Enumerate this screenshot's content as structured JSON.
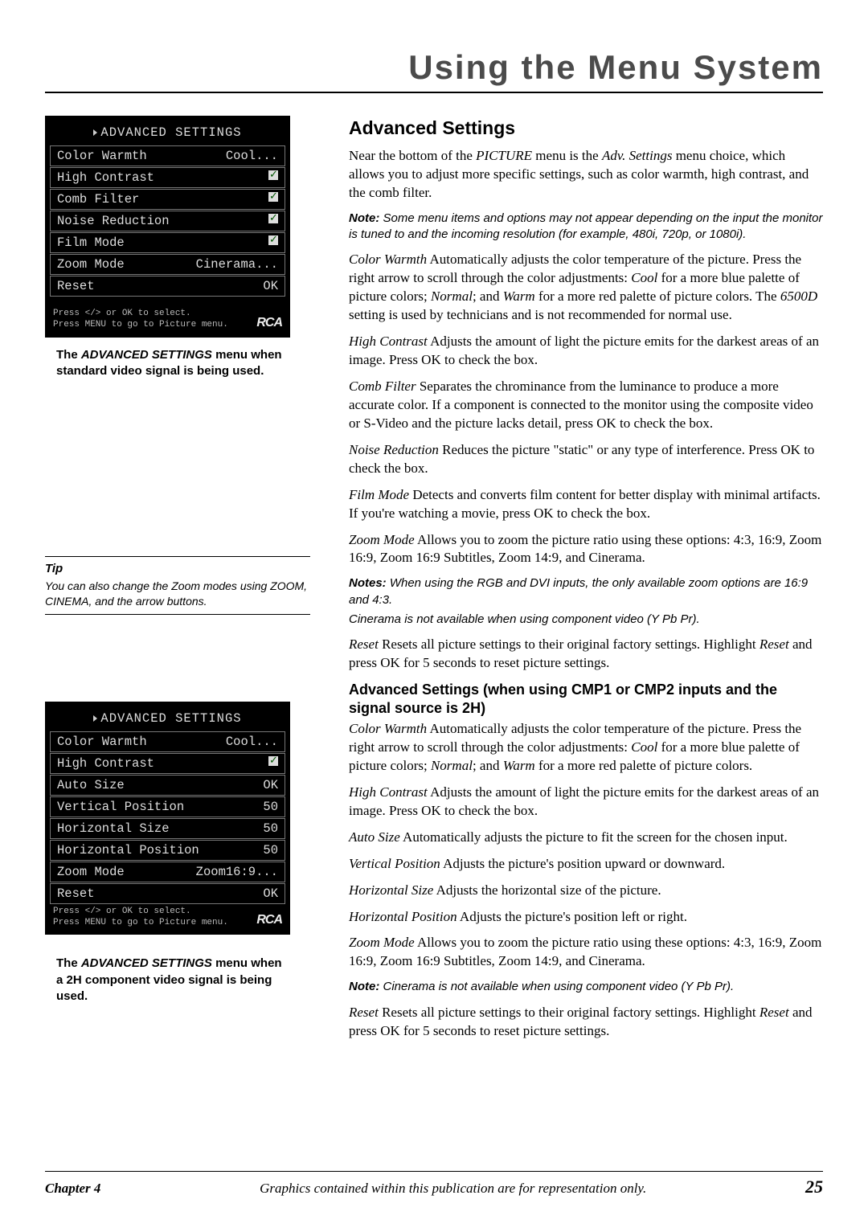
{
  "header": {
    "title": "Using the Menu System"
  },
  "osd1": {
    "title": "ADVANCED SETTINGS",
    "rows": [
      {
        "label": "Color Warmth",
        "value": "Cool...",
        "check": false
      },
      {
        "label": "High Contrast",
        "value": "",
        "check": true
      },
      {
        "label": "Comb Filter",
        "value": "",
        "check": true
      },
      {
        "label": "Noise Reduction",
        "value": "",
        "check": true
      },
      {
        "label": "Film Mode",
        "value": "",
        "check": true
      },
      {
        "label": "Zoom Mode",
        "value": "Cinerama...",
        "check": false
      },
      {
        "label": "Reset",
        "value": "OK",
        "check": false
      }
    ],
    "foot1": "Press </> or OK to select.",
    "foot2": "Press MENU to go to Picture menu.",
    "brand": "RCA"
  },
  "caption1_a": "The ",
  "caption1_b": "ADVANCED SETTINGS",
  "caption1_c": " menu when standard video signal is being used.",
  "tip": {
    "title": "Tip",
    "body": "You can also change the Zoom modes using ZOOM, CINEMA, and the arrow buttons."
  },
  "osd2": {
    "title": "ADVANCED SETTINGS",
    "rows": [
      {
        "label": "Color Warmth",
        "value": "Cool...",
        "check": false
      },
      {
        "label": "High Contrast",
        "value": "",
        "check": true
      },
      {
        "label": "Auto Size",
        "value": "OK",
        "check": false
      },
      {
        "label": "Vertical Position",
        "value": "50",
        "check": false
      },
      {
        "label": "Horizontal Size",
        "value": "50",
        "check": false
      },
      {
        "label": "Horizontal Position",
        "value": "50",
        "check": false
      },
      {
        "label": "Zoom Mode",
        "value": "Zoom16:9...",
        "check": false
      },
      {
        "label": "Reset",
        "value": "OK",
        "check": false
      }
    ],
    "foot1": "Press </> or OK to select.",
    "foot2": "Press MENU to go to Picture menu.",
    "brand": "RCA"
  },
  "caption2_a": "The ",
  "caption2_b": "ADVANCED SETTINGS",
  "caption2_c": " menu when a 2H component video signal is being used.",
  "right": {
    "h2": "Advanced Settings",
    "intro1": "Near the bottom of the ",
    "intro2": "PICTURE",
    "intro3": " menu is the ",
    "intro4": "Adv. Settings",
    "intro5": " menu choice, which allows you to adjust more specific settings, such as color warmth, high contrast, and the comb filter.",
    "note1_label": "Note:",
    "note1_body": " Some menu items and options may not appear depending on the input the monitor is tuned to and the incoming resolution (for example, 480i, 720p, or 1080i).",
    "cw_t": "Color Warmth",
    "cw_b1": "   Automatically adjusts the color temperature of the picture. Press the right arrow to scroll through the color adjustments: ",
    "cw_cool": "Cool",
    "cw_b2": " for a more blue palette of picture colors; ",
    "cw_normal": "Normal",
    "cw_b3": "; and ",
    "cw_warm": "Warm",
    "cw_b4": " for a more red palette of picture colors. The ",
    "cw_6500": "6500D",
    "cw_b5": " setting is used by technicians and is not recommended for normal use.",
    "hc_t": "High Contrast",
    "hc_b": "   Adjusts the amount of light the picture emits for the darkest areas of an image. Press OK to check the box.",
    "cf_t": "Comb Filter",
    "cf_b": "   Separates the chrominance from the luminance to produce a more accurate color. If a component is connected to the monitor using the composite video or S-Video and the picture lacks detail, press OK to check the box.",
    "nr_t": "Noise Reduction",
    "nr_b": "    Reduces the picture \"static\" or any type of interference. Press OK to check the box.",
    "fm_t": "Film Mode",
    "fm_b": "   Detects and converts film content for better display with minimal artifacts. If you're watching a movie, press OK to check the box.",
    "zm_t": "Zoom Mode",
    "zm_b": "   Allows you to zoom the picture ratio using these options: 4:3, 16:9, Zoom 16:9, Zoom 16:9 Subtitles, Zoom 14:9, and Cinerama.",
    "notes2_label": "Notes:",
    "notes2_a": " When using the RGB and DVI inputs, the only available zoom options are 16:9 and 4:3.",
    "notes2_b": "Cinerama is not available when using component video (Y Pb Pr).",
    "rs_t": "Reset",
    "rs_b1": "   Resets all picture settings to their original factory settings. Highlight ",
    "rs_reset": "Reset",
    "rs_b2": " and press OK for 5 seconds to reset picture settings.",
    "h3": "Advanced Settings (when using CMP1 or CMP2 inputs and the signal source is 2H)",
    "cw2_t": "Color Warmth",
    "cw2_b1": "   Automatically adjusts the color temperature of the picture. Press the right arrow to scroll through the color adjustments: ",
    "cw2_cool": "Cool",
    "cw2_b2": " for a more blue palette of picture colors; ",
    "cw2_normal": "Normal",
    "cw2_b3": "; and ",
    "cw2_warm": "Warm",
    "cw2_b4": " for a more red palette of picture colors.",
    "hc2_t": "High Contrast",
    "hc2_b": "   Adjusts the amount of light the picture emits for the darkest areas of an image. Press OK to check the box.",
    "as_t": "Auto Size",
    "as_b": "   Automatically adjusts the picture to fit the screen for the chosen input.",
    "vp_t": "Vertical Position",
    "vp_b": "   Adjusts the picture's position upward or downward.",
    "hs_t": "Horizontal Size",
    "hs_b": "   Adjusts the horizontal size of the picture.",
    "hp_t": "Horizontal Position",
    "hp_b": "   Adjusts the picture's position left or right.",
    "zm2_t": "Zoom Mode",
    "zm2_b": "   Allows you to zoom the picture ratio using these options: 4:3, 16:9, Zoom 16:9, Zoom 16:9 Subtitles, Zoom 14:9, and Cinerama.",
    "note3_label": "Note:",
    "note3_body": " Cinerama is not available when using component video (Y Pb Pr).",
    "rs2_t": "Reset",
    "rs2_b1": "   Resets all picture settings to their original factory settings. Highlight ",
    "rs2_reset": "Reset",
    "rs2_b2": " and press OK for 5 seconds to reset picture settings."
  },
  "footer": {
    "chapter": "Chapter 4",
    "mid": "Graphics contained within this publication are for representation only.",
    "page": "25"
  }
}
